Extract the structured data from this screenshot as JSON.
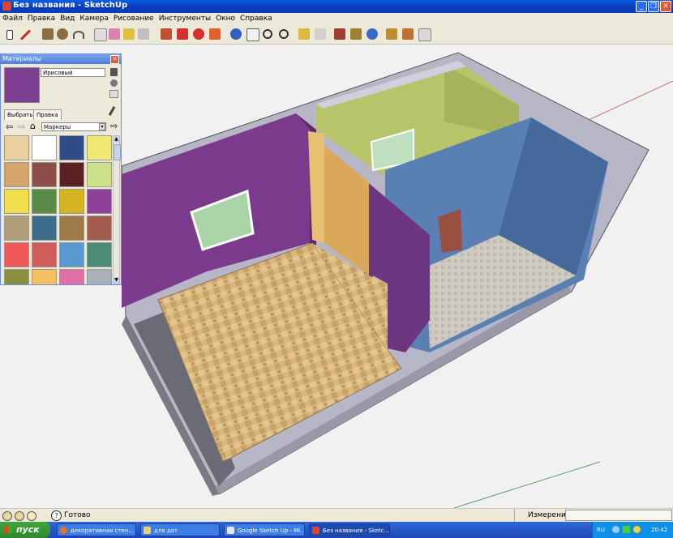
{
  "window": {
    "title": "Без названия - SketchUp"
  },
  "menu": [
    "Файл",
    "Правка",
    "Вид",
    "Камера",
    "Рисование",
    "Инструменты",
    "Окно",
    "Справка"
  ],
  "toolbar_icons": [
    "select-icon",
    "pencil-icon",
    "rectangle-icon",
    "circle-icon",
    "arc-icon",
    "eraser-icon",
    "paint-bucket-icon",
    "push-pull-icon",
    "follow-me-icon",
    "move-icon",
    "rotate-icon",
    "offset-icon",
    "orbit-icon",
    "pan-icon",
    "zoom-icon",
    "zoom-extents-icon",
    "section-icon",
    "walk-icon",
    "position-camera-icon",
    "look-around-icon",
    "components-icon",
    "materials-icon",
    "styles-icon"
  ],
  "materials_panel": {
    "title": "Материалы",
    "current_material": "Ирисовый",
    "tabs": [
      "Выбрать",
      "Правка"
    ],
    "library": "Маркеры",
    "current_color": "#7e3f93",
    "swatches": [
      "#eccfa0",
      "#ffffff",
      "#2f4c86",
      "#eee872",
      "#d4a46c",
      "#8c4f48",
      "#5a2024",
      "#cfe08a",
      "#f2df50",
      "#5a8a48",
      "#d5b420",
      "#8e4199",
      "#b09c78",
      "#3d6c8c",
      "#9e7a48",
      "#a25c50",
      "#ee5858",
      "#d05c5c",
      "#5a98d0",
      "#4c8c74",
      "#889040",
      "#f4c060",
      "#e070a4",
      "#a8b0b8"
    ]
  },
  "status": {
    "text": "Готово",
    "measure_label": "Измерения"
  },
  "taskbar": {
    "start": "пуск",
    "tasks": [
      "декоративная стен...",
      "для дат",
      "Google Sketch Up - Mi...",
      "Без названия - Sketc..."
    ],
    "lang": "RU",
    "time": "20:42"
  }
}
